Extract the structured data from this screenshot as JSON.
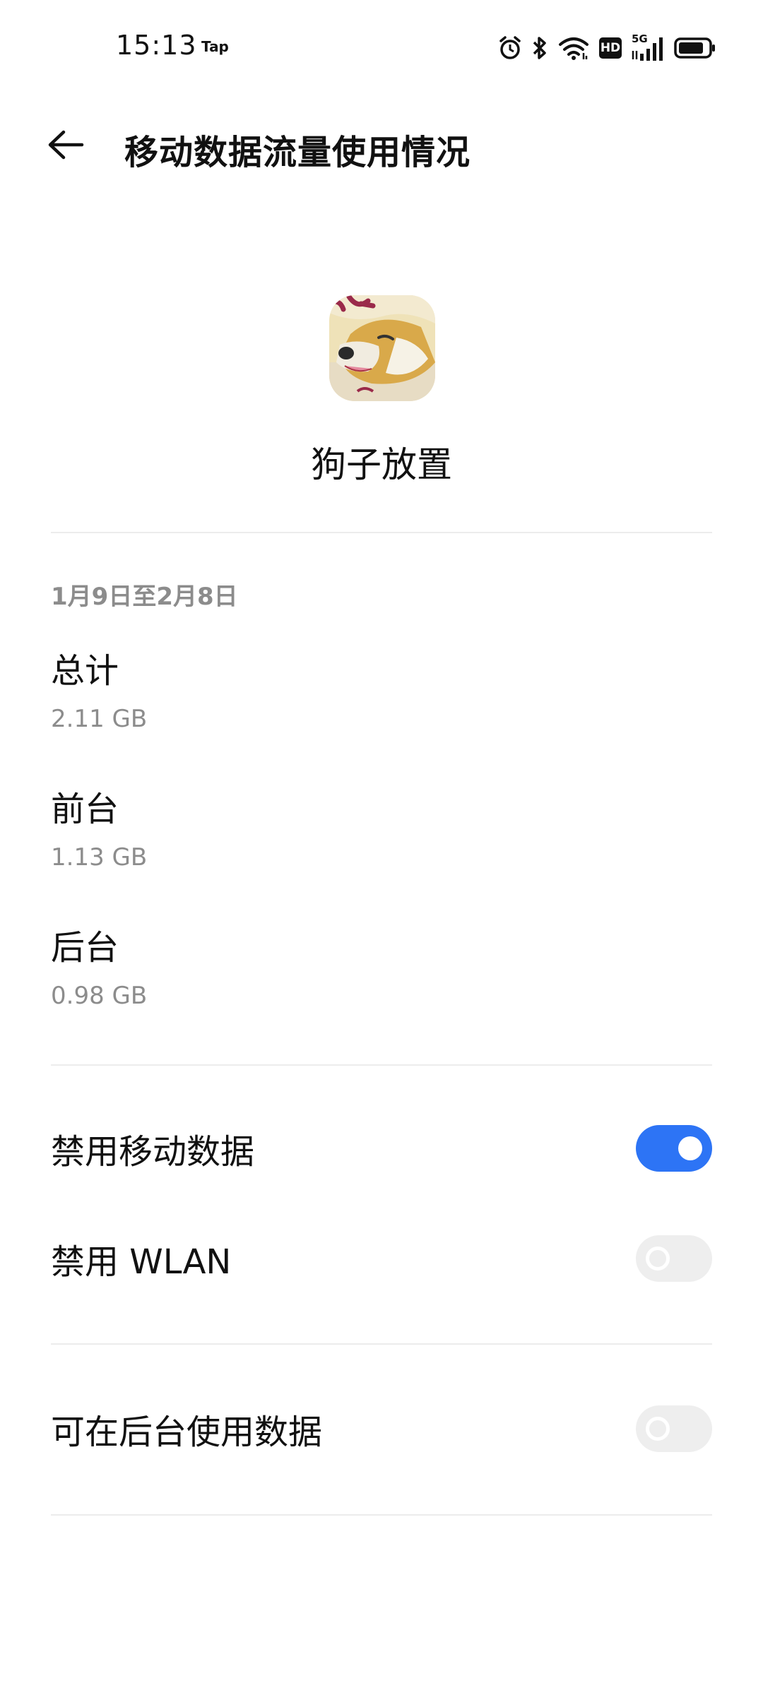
{
  "status_bar": {
    "time": "15:13",
    "notification": "Tap",
    "hd_badge": "HD",
    "network": "5G",
    "icons": [
      "alarm-icon",
      "bluetooth-icon",
      "wifi-icon",
      "hd-icon",
      "signal-icon",
      "battery-icon"
    ]
  },
  "header": {
    "title": "移动数据流量使用情况",
    "back_icon": "arrow-left-icon"
  },
  "app": {
    "name": "狗子放置",
    "icon": "dog-app-icon"
  },
  "usage": {
    "period": "1月9日至2月8日",
    "items": [
      {
        "label": "总计",
        "value": "2.11 GB"
      },
      {
        "label": "前台",
        "value": "1.13 GB"
      },
      {
        "label": "后台",
        "value": "0.98 GB"
      }
    ]
  },
  "settings": [
    {
      "label": "禁用移动数据",
      "enabled": true
    },
    {
      "label": "禁用 WLAN",
      "enabled": false
    },
    {
      "label": "可在后台使用数据",
      "enabled": false
    }
  ],
  "colors": {
    "accent": "#2d74f5",
    "toggle_off": "#eeeeee",
    "secondary_text": "#8c8c8c",
    "divider": "#ececec"
  }
}
